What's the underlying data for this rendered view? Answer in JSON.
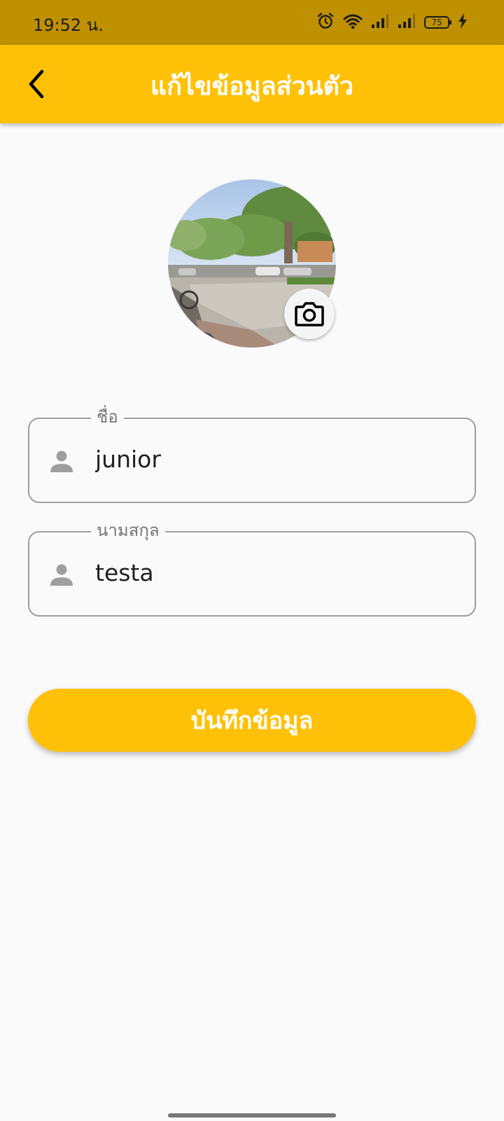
{
  "status_bar": {
    "time": "19:52 น.",
    "battery_level": "75",
    "icons": [
      "alarm-icon",
      "wifi-icon",
      "signal-icon",
      "signal-icon",
      "battery-icon",
      "charging-icon"
    ]
  },
  "app_bar": {
    "title": "แก้ไขข้อมูลส่วนตัว",
    "back_icon": "chevron-left-icon"
  },
  "avatar": {
    "camera_icon": "camera-icon"
  },
  "form": {
    "first_name": {
      "label": "ชื่อ",
      "value": "junior",
      "icon": "person-icon"
    },
    "last_name": {
      "label": "นามสกุล",
      "value": "testa",
      "icon": "person-icon"
    }
  },
  "save_button": {
    "label": "บันทึกข้อมูล"
  },
  "colors": {
    "status_bar": "#bf9000",
    "accent": "#ffc107",
    "background": "#fafafa",
    "field_border": "#9e9e9e",
    "icon_grey": "#9e9e9e"
  }
}
